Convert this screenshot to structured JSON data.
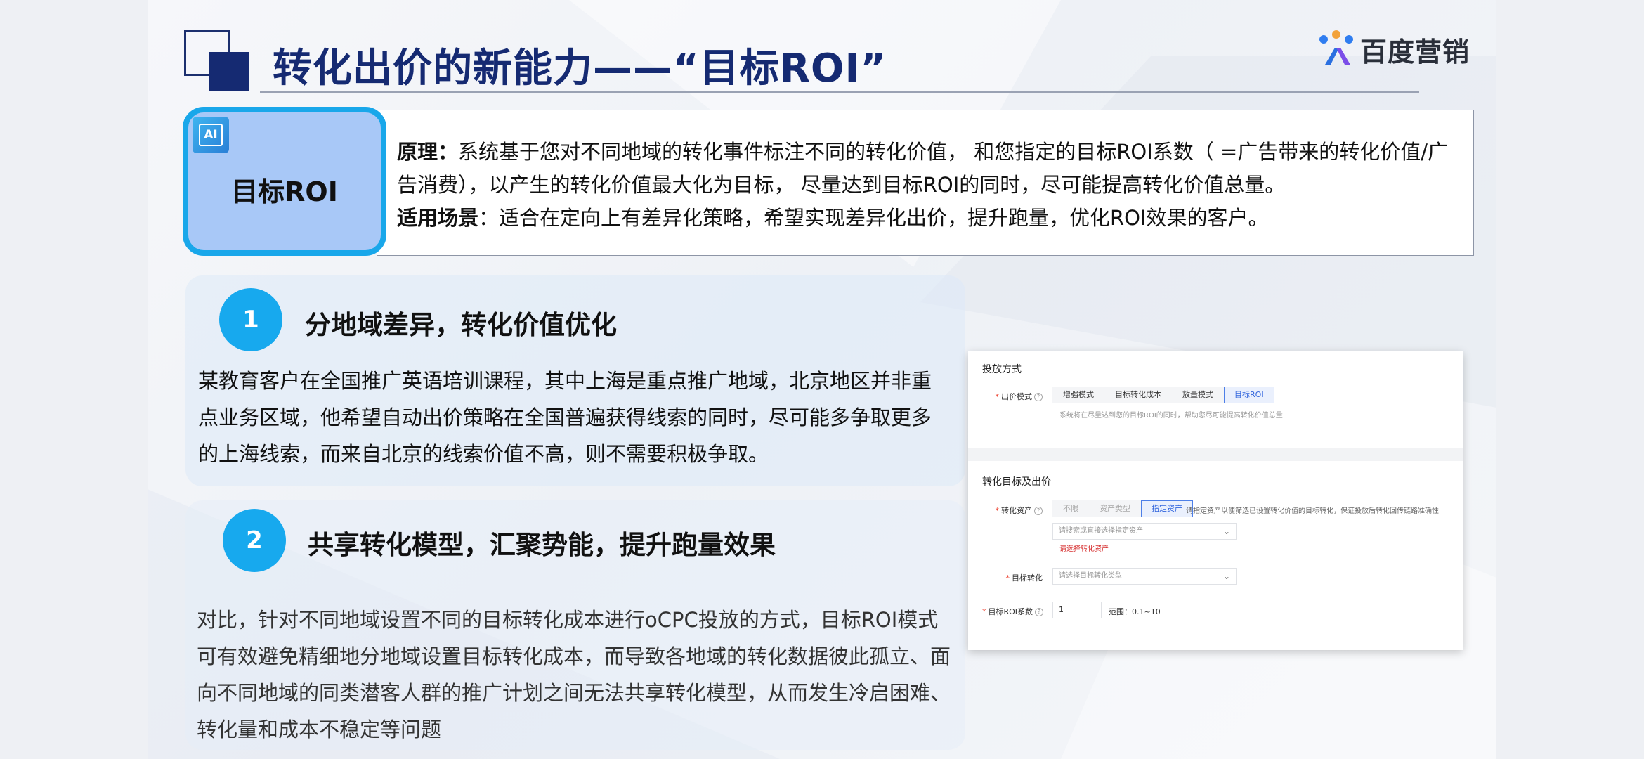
{
  "header": {
    "title": "转化出价的新能力——“目标ROI”",
    "logo_text": "百度营销"
  },
  "roi": {
    "badge_icon_text": "AI",
    "badge_label": "目标ROI",
    "principle_label": "原理：",
    "principle_text": "系统基于您对不同地域的转化事件标注不同的转化价值， 和您指定的目标ROI系数（ =广告带来的转化价值/广告消费），以产生的转化价值最大化为目标， 尽量达到目标ROI的同时，尽可能提高转化价值总量。",
    "scenario_label": "适用场景",
    "scenario_text": "：适合在定向上有差异化策略，希望实现差异化出价，提升跑量，优化ROI效果的客户。"
  },
  "sections": [
    {
      "number": "1",
      "title": "分地域差异，转化价值优化",
      "body": "某教育客户在全国推广英语培训课程，其中上海是重点推广地域，北京地区并非重点业务区域，他希望自动出价策略在全国普遍获得线索的同时，尽可能多争取更多的上海线索，而来自北京的线索价值不高，则不需要积极争取。"
    },
    {
      "number": "2",
      "title": "共享转化模型，汇聚势能，提升跑量效果",
      "body": "对比，针对不同地域设置不同的目标转化成本进行oCPC投放的方式，目标ROI模式可有效避免精细地分地域设置目标转化成本，而导致各地域的转化数据彼此孤立、面向不同地域的同类潜客人群的推广计划之间无法共享转化模型，从而发生冷启困难、转化量和成本不稳定等问题"
    }
  ],
  "screenshot": {
    "section1_title": "投放方式",
    "bid_mode_label": "出价模式",
    "bid_mode_options": [
      "增强模式",
      "目标转化成本",
      "放量模式",
      "目标ROI"
    ],
    "bid_mode_selected": "目标ROI",
    "bid_mode_hint": "系统将在尽量达到您的目标ROI的同时，帮助您尽可能提高转化价值总量",
    "section2_title": "转化目标及出价",
    "asset_label": "转化资产",
    "asset_options": [
      "不限",
      "资产类型",
      "指定资产"
    ],
    "asset_selected": "指定资产",
    "asset_hint": "请指定资产以便筛选已设置转化价值的目标转化，保证投放后转化回传链路准确性",
    "asset_select_placeholder": "请搜索或直接选择指定资产",
    "asset_error": "请选择转化资产",
    "target_label": "目标转化",
    "target_placeholder": "请选择目标转化类型",
    "roi_coef_label": "目标ROI系数",
    "roi_coef_value": "1",
    "roi_range": "范围：0.1~10",
    "required_mark": "*",
    "help_mark": "?",
    "chevron": "⌄"
  },
  "colors": {
    "title_navy": "#152a72",
    "accent_blue": "#17a9ee",
    "badge_fill": "#a8c8f7"
  }
}
